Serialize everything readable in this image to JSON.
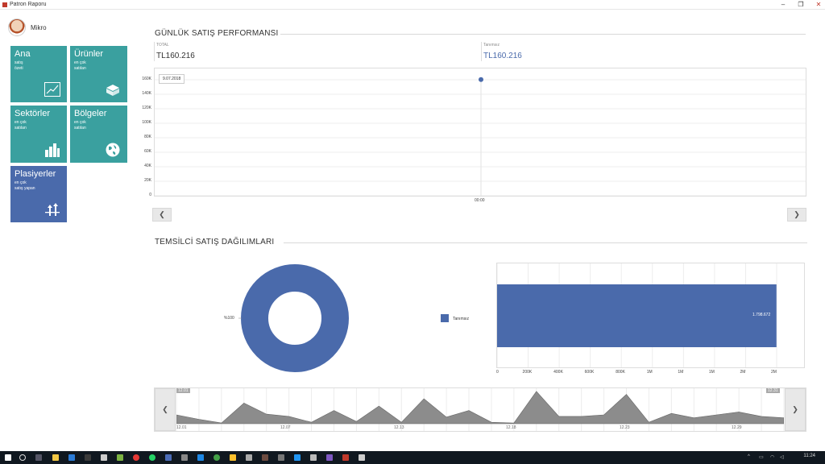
{
  "window": {
    "title": "Patron Raporu",
    "min": "–",
    "restore": "❐",
    "close": "✕"
  },
  "user": {
    "name": "Mikro"
  },
  "tiles": [
    {
      "title": "Ana",
      "sub1": "satış",
      "sub2": "özeti",
      "icon": "chart-icon"
    },
    {
      "title": "Ürünler",
      "sub1": "en çok",
      "sub2": "satılan",
      "icon": "box-icon"
    },
    {
      "title": "Sektörler",
      "sub1": "en çok",
      "sub2": "satılan",
      "icon": "bar-chart-icon"
    },
    {
      "title": "Bölgeler",
      "sub1": "en çok",
      "sub2": "satılan",
      "icon": "globe-icon"
    },
    {
      "title": "Plasiyerler",
      "sub1": "en çok",
      "sub2": "satış yapan",
      "icon": "arrows-icon"
    }
  ],
  "daily": {
    "title": "GÜNLÜK SATIŞ PERFORMANSI",
    "kpi": [
      {
        "label": "TOTAL",
        "value": "TL160.216"
      },
      {
        "label": "Tanımsız",
        "value": "TL160.216"
      }
    ],
    "tooltip": "9.07.2018",
    "x_tick": "00:00",
    "prev": "❮",
    "next": "❯"
  },
  "rep": {
    "title": "TEMSİLCİ SATIŞ DAĞILIMLARI",
    "donut_label": "%100",
    "legend": "Tanımsız",
    "bar_value": "1.798.672",
    "prev": "❮",
    "next": "❯",
    "range_start": "12.01",
    "range_end": "12.31"
  },
  "taskbar": {
    "time": "11:24"
  },
  "colors": {
    "teal": "#3aa09f",
    "blue": "#4a6aab",
    "area": "#8c8c8c"
  },
  "chart_data": [
    {
      "type": "scatter",
      "title": "",
      "x": [
        "00:00"
      ],
      "series": [
        {
          "values": [
            160216
          ]
        }
      ],
      "yticks": [
        "0",
        "20K",
        "40K",
        "60K",
        "80K",
        "100K",
        "120K",
        "140K",
        "160K"
      ],
      "ylim": [
        0,
        160000
      ]
    },
    {
      "type": "pie",
      "labels": [
        "Tanımsız"
      ],
      "values": [
        100
      ]
    },
    {
      "type": "bar",
      "orientation": "horizontal",
      "categories": [
        "Tanımsız"
      ],
      "values": [
        1798672
      ],
      "xticks": [
        "0",
        "200K",
        "400K",
        "600K",
        "800K",
        "1M",
        "1M",
        "1M",
        "2M",
        "2M"
      ],
      "xlim": [
        0,
        1800000
      ]
    },
    {
      "type": "area",
      "x_labels": [
        "12.01",
        "12.07",
        "12.13",
        "12.18",
        "12.23",
        "12.29"
      ],
      "values": [
        12,
        6,
        1,
        28,
        13,
        10,
        2,
        18,
        3,
        24,
        2,
        34,
        9,
        18,
        2,
        1,
        44,
        10,
        10,
        12,
        40,
        2,
        14,
        8,
        12,
        16,
        10,
        8
      ]
    }
  ]
}
